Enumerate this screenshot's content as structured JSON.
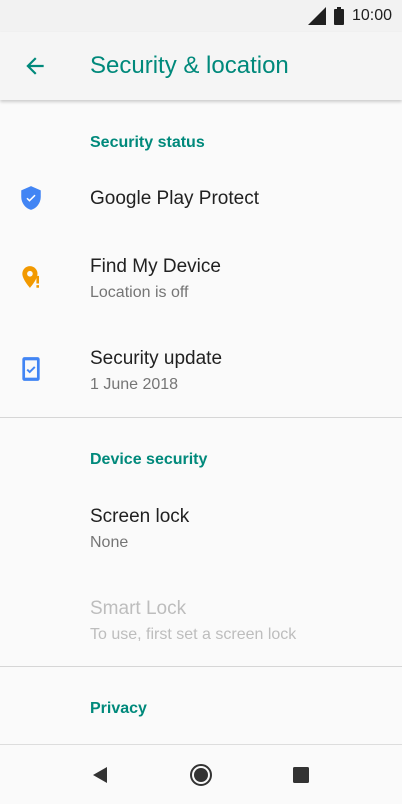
{
  "status_bar": {
    "time": "10:00",
    "icons": [
      "signal-icon",
      "battery-icon"
    ]
  },
  "app_bar": {
    "back_icon": "arrow-back-icon",
    "title": "Security & location",
    "accent_color": "#00897b"
  },
  "sections": {
    "security_status": {
      "header": "Security status",
      "items": [
        {
          "title": "Google Play Protect",
          "summary": "",
          "icon": "shield-check-icon"
        },
        {
          "title": "Find My Device",
          "summary": "Location is off",
          "icon": "location-alert-icon"
        },
        {
          "title": "Security update",
          "summary": "1 June 2018",
          "icon": "phone-check-icon"
        }
      ]
    },
    "device_security": {
      "header": "Device security",
      "items": [
        {
          "title": "Screen lock",
          "summary": "None"
        },
        {
          "title": "Smart Lock",
          "summary": "To use, first set a screen lock",
          "disabled": true
        }
      ]
    },
    "privacy": {
      "header": "Privacy"
    }
  },
  "nav_bar": {
    "buttons": [
      "back-triangle-icon",
      "home-circle-icon",
      "recents-square-icon"
    ]
  }
}
